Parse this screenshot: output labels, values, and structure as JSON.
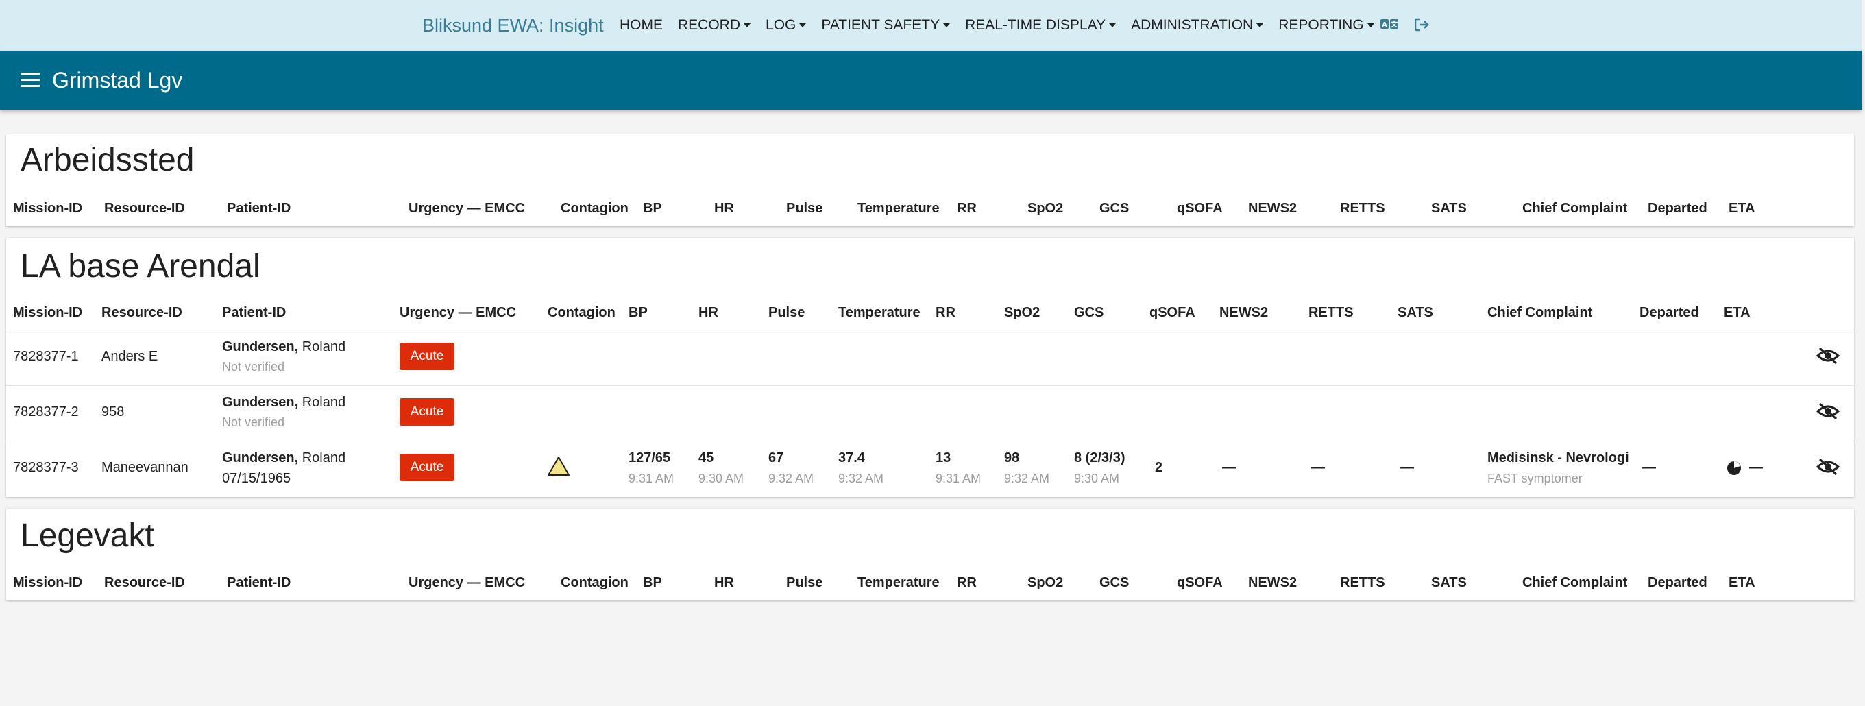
{
  "app": {
    "brand": "Bliksund EWA: Insight",
    "nav": [
      {
        "label": "HOME",
        "dropdown": false
      },
      {
        "label": "RECORD",
        "dropdown": true
      },
      {
        "label": "LOG",
        "dropdown": true
      },
      {
        "label": "PATIENT SAFETY",
        "dropdown": true
      },
      {
        "label": "REAL-TIME DISPLAY",
        "dropdown": true
      },
      {
        "label": "ADMINISTRATION",
        "dropdown": true
      },
      {
        "label": "REPORTING",
        "dropdown": true
      }
    ],
    "icons": [
      "translate-icon",
      "logout-icon"
    ]
  },
  "appbar": {
    "title": "Grimstad Lgv"
  },
  "columns": [
    "Mission-ID",
    "Resource-ID",
    "Patient-ID",
    "Urgency — EMCC",
    "Contagion",
    "BP",
    "HR",
    "Pulse",
    "Temperature",
    "RR",
    "SpO2",
    "GCS",
    "qSOFA",
    "NEWS2",
    "RETTS",
    "SATS",
    "Chief Complaint",
    "Departed",
    "ETA"
  ],
  "sections": [
    {
      "title": "Arbeidssted",
      "rows": []
    },
    {
      "title": "LA base Arendal",
      "rows": [
        {
          "mission_id": "7828377-1",
          "resource_id": "Anders E",
          "patient_last": "Gundersen,",
          "patient_first": "Roland",
          "patient_sub": "Not verified",
          "urgency": "Acute"
        },
        {
          "mission_id": "7828377-2",
          "resource_id": "958",
          "patient_last": "Gundersen,",
          "patient_first": "Roland",
          "patient_sub": "Not verified",
          "urgency": "Acute"
        },
        {
          "mission_id": "7828377-3",
          "resource_id": "Maneevannan",
          "patient_last": "Gundersen,",
          "patient_first": "Roland",
          "patient_sub": "07/15/1965",
          "urgency": "Acute",
          "contagion": "warning-triangle-icon",
          "bp": "127/65",
          "bp_time": "9:31 AM",
          "hr": "45",
          "hr_time": "9:30 AM",
          "pulse": "67",
          "pulse_time": "9:32 AM",
          "temperature": "37.4",
          "temperature_time": "9:32 AM",
          "rr": "13",
          "rr_time": "9:31 AM",
          "spo2": "98",
          "spo2_time": "9:32 AM",
          "gcs": "8 (2/3/3)",
          "gcs_time": "9:30 AM",
          "qsofa": "2",
          "news2": "—",
          "retts": "—",
          "sats": "—",
          "chief_complaint": "Medisinsk - Nevrologi",
          "chief_complaint_sub": "FAST symptomer",
          "departed": "—",
          "eta": "—"
        }
      ]
    },
    {
      "title": "Legevakt",
      "rows": []
    }
  ],
  "colors": {
    "topnav_bg": "#d8edf3",
    "brand": "#3a7e96",
    "appbar_bg": "#006a8a",
    "acute_badge": "#dd2c0a",
    "contagion_fill": "#f5e68c"
  }
}
